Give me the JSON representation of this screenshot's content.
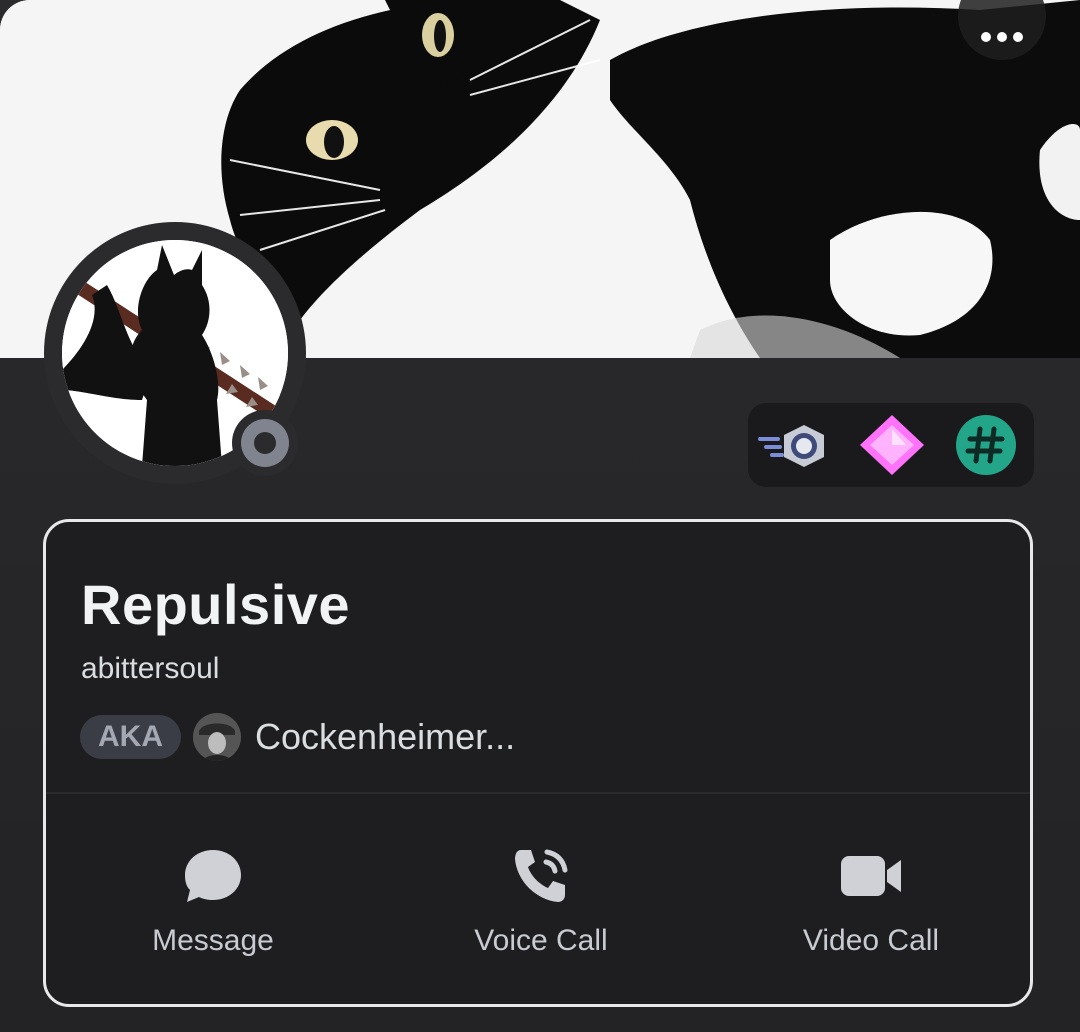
{
  "profile": {
    "display_name": "Repulsive",
    "username": "abittersoul",
    "aka_label": "AKA",
    "aka_name": "Cockenheimer...",
    "status": "offline"
  },
  "badges": [
    {
      "icon": "nitro-badge-icon",
      "color": "#c7cbd6"
    },
    {
      "icon": "gem-badge-icon",
      "color": "#ff73fa"
    },
    {
      "icon": "hashtag-badge-icon",
      "color": "#23a55a"
    }
  ],
  "actions": {
    "message": "Message",
    "voice_call": "Voice Call",
    "video_call": "Video Call"
  },
  "icons": {
    "more": "more-dots-icon",
    "message": "chat-bubble-icon",
    "voice": "phone-call-icon",
    "video": "video-camera-icon"
  },
  "colors": {
    "card_bg": "#1e1e20",
    "card_border": "#e8e8ea",
    "status_offline": "#80848e",
    "aka_pill": "#3a3d45"
  }
}
